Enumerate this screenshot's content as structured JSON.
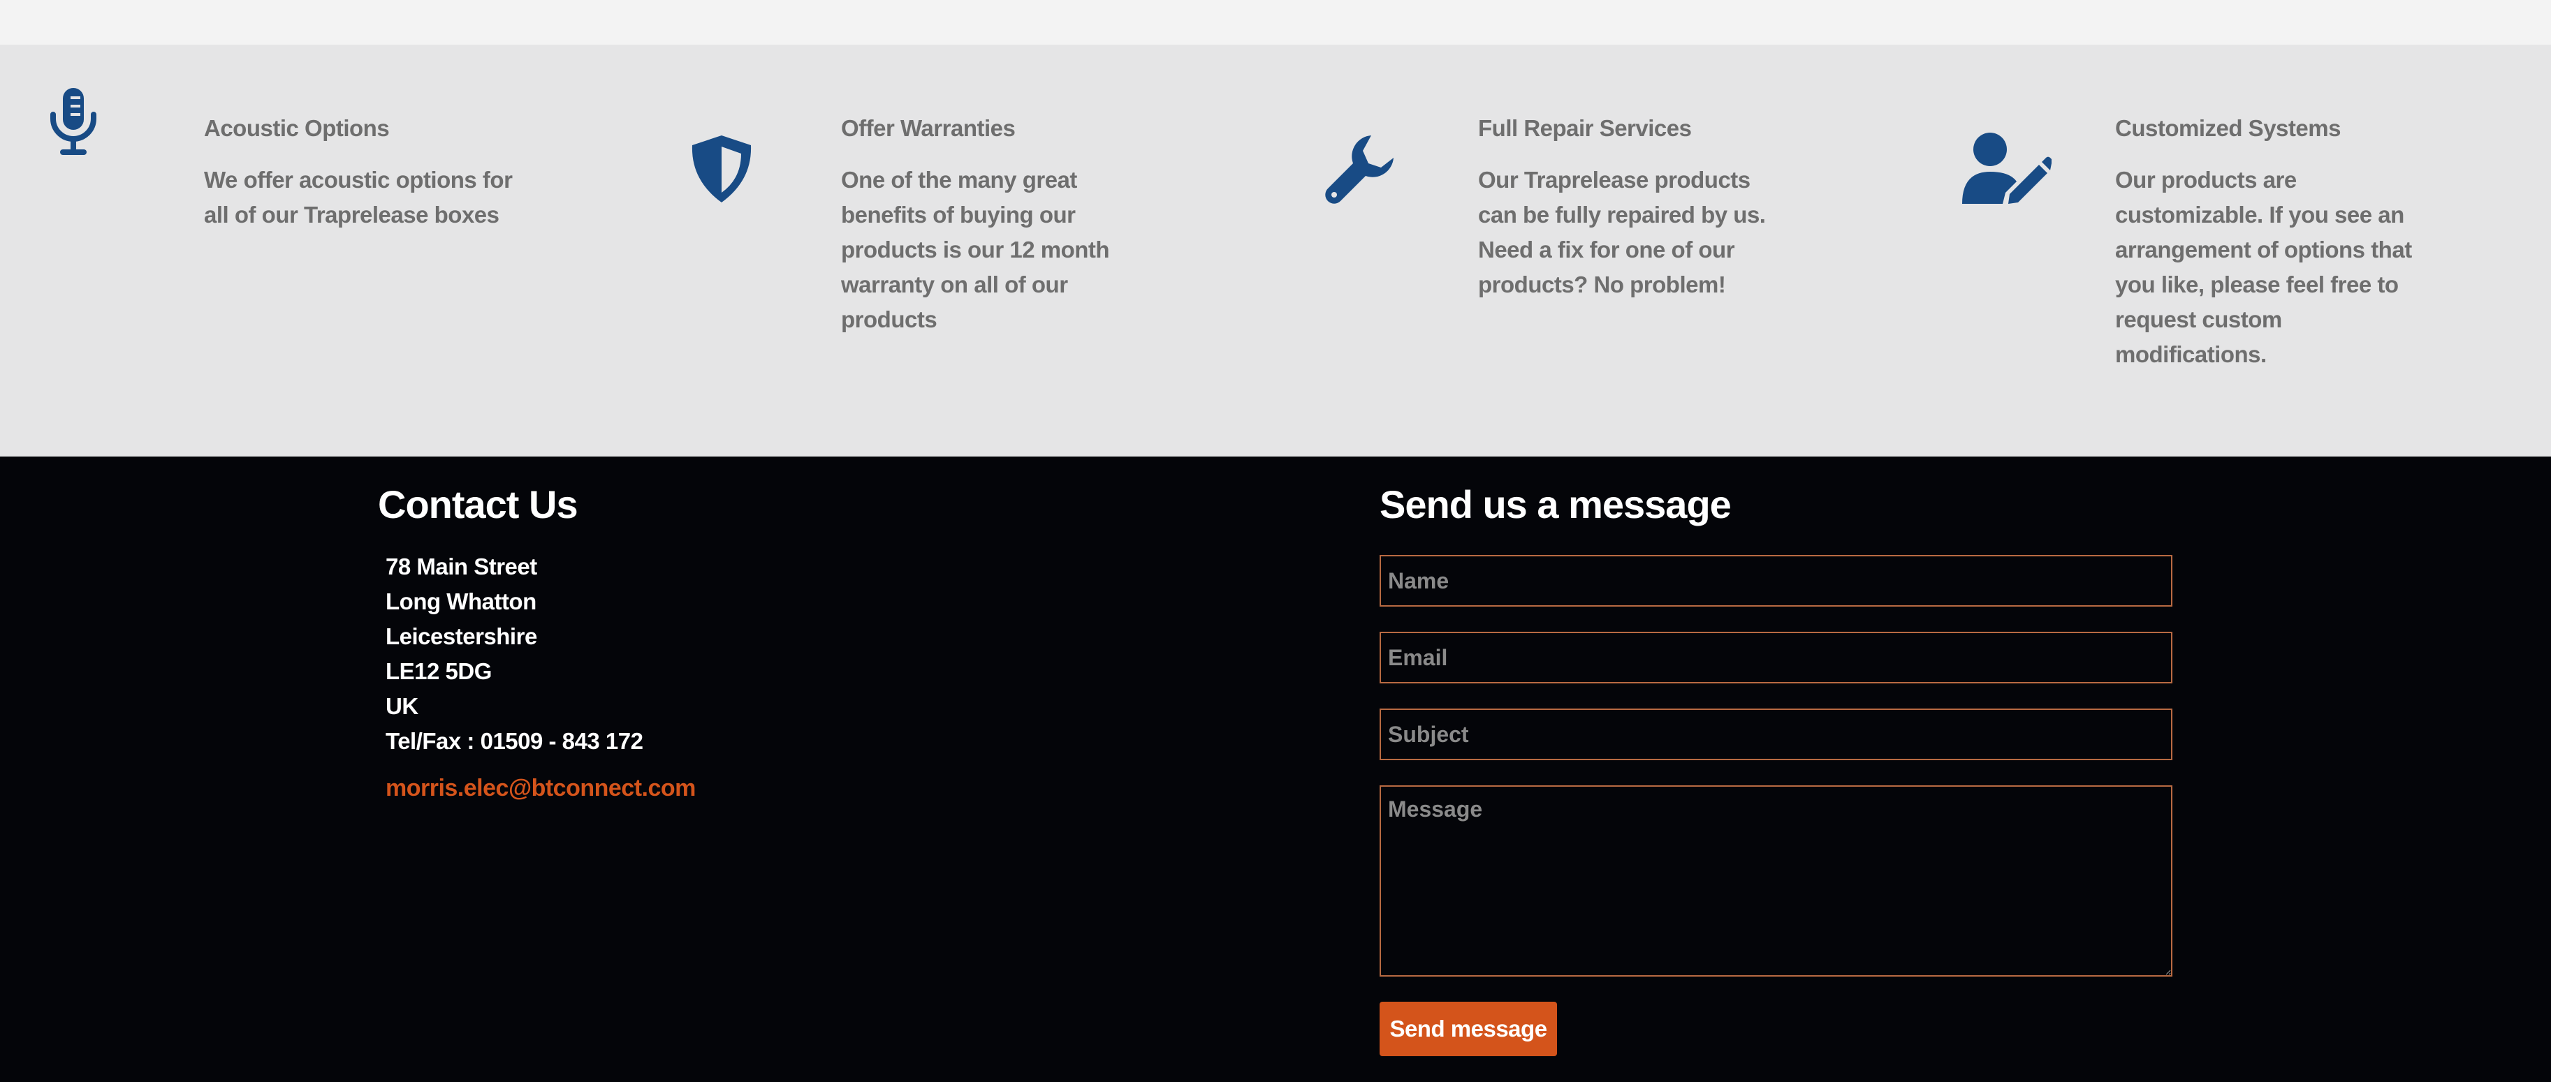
{
  "colors": {
    "accent": "#d4541b",
    "icon": "#184b85",
    "feature_bg": "#e5e5e6",
    "footer_bg": "#040509",
    "field_border": "#b86a42"
  },
  "features": [
    {
      "icon": "microphone-icon",
      "title": "Acoustic Options",
      "lines": [
        "We offer acoustic options for",
        "all of our Traprelease boxes"
      ]
    },
    {
      "icon": "shield-icon",
      "title": "Offer Warranties",
      "lines": [
        "One of the many great",
        "benefits of buying our",
        "products is our 12 month",
        "warranty on all of our",
        "products"
      ]
    },
    {
      "icon": "wrench-icon",
      "title": "Full Repair Services",
      "lines": [
        "Our Traprelease products",
        "can be fully repaired by us.",
        "Need a fix for one of our",
        "products? No problem!"
      ]
    },
    {
      "icon": "user-edit-icon",
      "title": "Customized Systems",
      "lines": [
        "Our products are",
        "customizable. If you see an",
        "arrangement of options that",
        "you like, please feel free to",
        "request custom",
        "modifications."
      ]
    }
  ],
  "contact": {
    "heading": "Contact Us",
    "address": [
      "78 Main Street",
      "Long Whatton",
      "Leicestershire",
      "LE12 5DG",
      "UK",
      "Tel/Fax : 01509 - 843 172"
    ],
    "email": "morris.elec@btconnect.com"
  },
  "message_form": {
    "heading": "Send us a message",
    "name_placeholder": "Name",
    "email_placeholder": "Email",
    "subject_placeholder": "Subject",
    "message_placeholder": "Message",
    "submit_label": "Send message"
  }
}
